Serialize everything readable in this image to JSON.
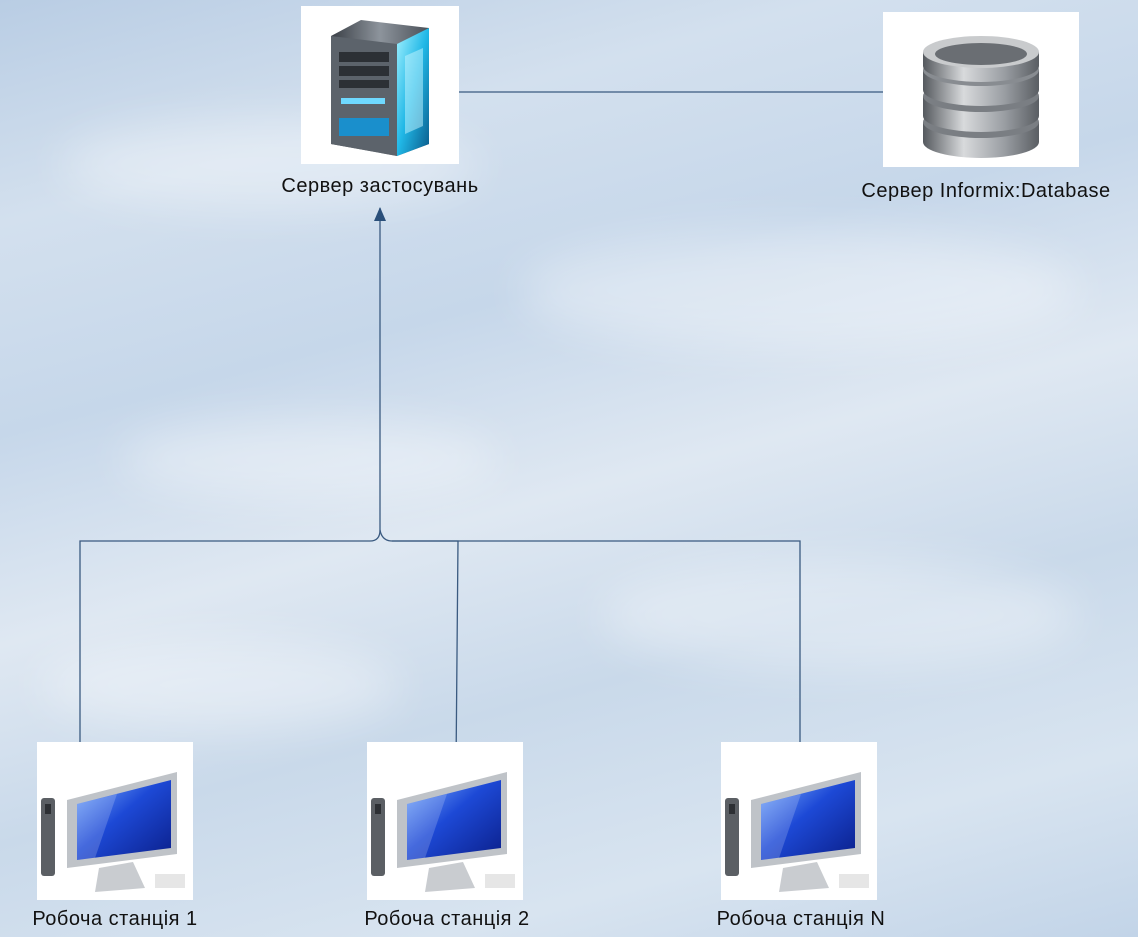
{
  "colors": {
    "connector": "#3a5a80",
    "arrowhead": "#2a4f7a"
  },
  "nodes": {
    "app_server": {
      "label": "Сервер застосувань",
      "icon": "server-tower-icon"
    },
    "db_server": {
      "label": "Сервер Informix:Database",
      "icon": "database-stack-icon"
    },
    "workstations": [
      {
        "label": "Робоча станція 1",
        "icon": "monitor-icon"
      },
      {
        "label": "Робоча станція 2",
        "icon": "monitor-icon"
      },
      {
        "label": "Робоча станція N",
        "icon": "monitor-icon"
      }
    ]
  },
  "edges": [
    {
      "from": "Сервер застосувань",
      "to": "Сервер Informix:Database",
      "arrows": "both"
    },
    {
      "from": "Робоча станція 1",
      "to": "Сервер застосувань",
      "arrows": "end"
    },
    {
      "from": "Робоча станція 2",
      "to": "Сервер застосувань",
      "arrows": "end"
    },
    {
      "from": "Робоча станція N",
      "to": "Сервер застосувань",
      "arrows": "end"
    }
  ]
}
